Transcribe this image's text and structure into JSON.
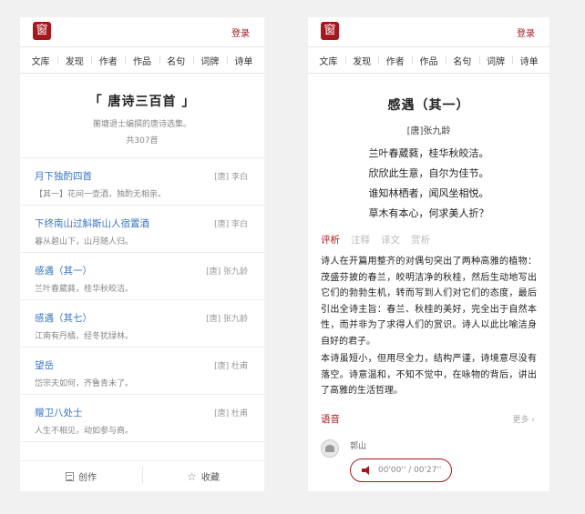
{
  "app": {
    "logo_text": "窗",
    "login_label": "登录"
  },
  "nav": [
    "文库",
    "发现",
    "作者",
    "作品",
    "名句",
    "词牌",
    "诗单"
  ],
  "left": {
    "hero": {
      "title": "「 唐诗三百首 」",
      "subtitle": "蘅塘退士编撰的唐诗选集。",
      "count": "共307首"
    },
    "poems": [
      {
        "title": "月下独酌四首",
        "author": "[唐] 李白",
        "excerpt": "【其一】花间一壶酒，独酌无相亲。"
      },
      {
        "title": "下终南山过斛斯山人宿置酒",
        "author": "[唐] 李白",
        "excerpt": "暮从碧山下，山月随人归。"
      },
      {
        "title": "感遇（其一）",
        "author": "[唐] 张九龄",
        "excerpt": "兰叶春葳蕤，桂华秋皎洁。"
      },
      {
        "title": "感遇（其七）",
        "author": "[唐] 张九龄",
        "excerpt": "江南有丹橘，经冬犹绿林。"
      },
      {
        "title": "望岳",
        "author": "[唐] 杜甫",
        "excerpt": "岱宗夫如何，齐鲁青未了。"
      },
      {
        "title": "赠卫八处士",
        "author": "[唐] 杜甫",
        "excerpt": "人生不相见，动如参与商。"
      }
    ],
    "bottom": {
      "create_label": "创作",
      "favorite_label": "收藏"
    }
  },
  "right": {
    "title": "感遇（其一）",
    "author": "[唐]张九龄",
    "verses": [
      "兰叶春葳蕤，桂华秋皎洁。",
      "欣欣此生意，自尔为佳节。",
      "谁知林栖者，闻风坐相悦。",
      "草木有本心，何求美人折？"
    ],
    "tabs": [
      "评析",
      "注释",
      "译文",
      "赏析"
    ],
    "paragraphs": [
      "诗人在开篇用整齐的对偶句突出了两种高雅的植物：茂盛芬披的春兰，皎明洁净的秋桂，然后生动地写出它们的勃勃生机，转而写到人们对它们的态度，最后引出全诗主旨：春兰、秋桂的美好，完全出于自然本性，而并非为了求得人们的赏识。诗人以此比喻洁身自好的君子。",
      "本诗虽短小，但用尽全力，结构严谨，诗境意尽没有落空。诗意温和，不知不觉中，在咏物的背后，讲出了高雅的生活哲理。"
    ],
    "audio": {
      "title": "语音",
      "more": "更多 ›",
      "reader": "郭山",
      "time": "00'00'' / 00'27''"
    }
  }
}
